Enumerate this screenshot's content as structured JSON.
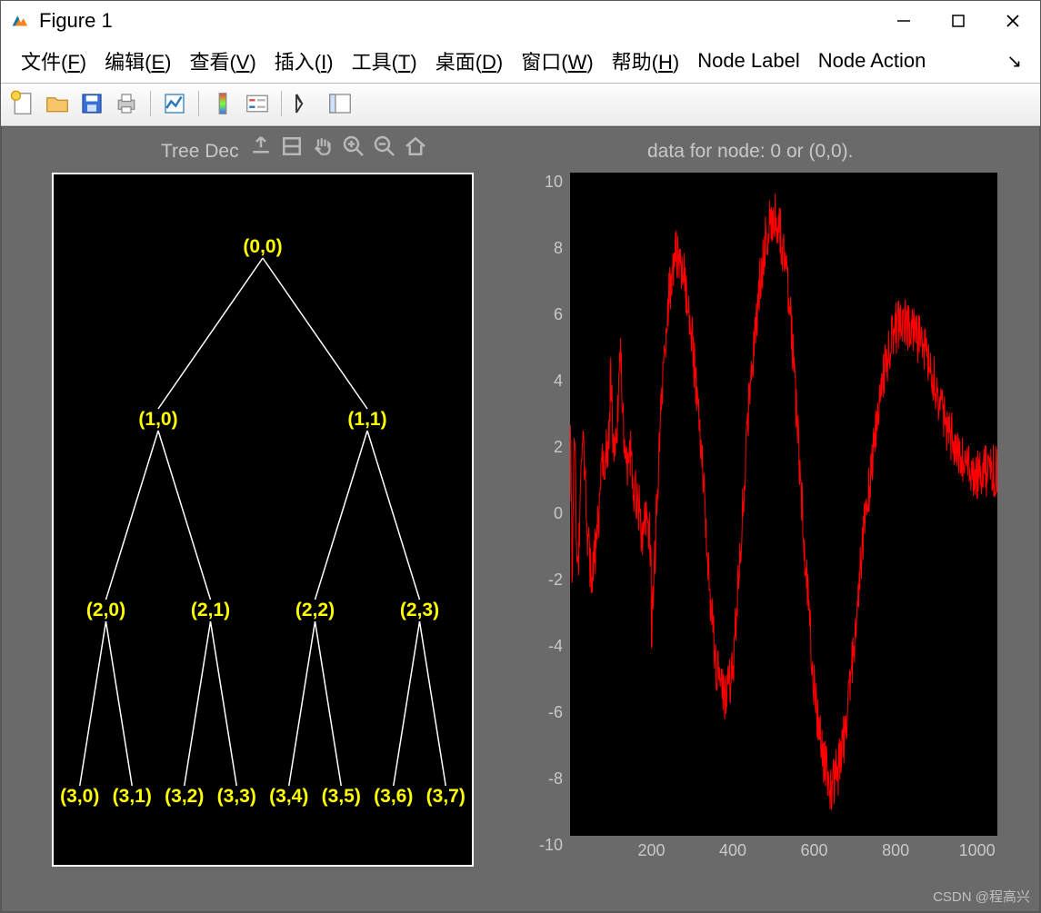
{
  "window": {
    "title": "Figure 1"
  },
  "menu": {
    "file": "文件(F)",
    "edit": "编辑(E)",
    "view": "查看(V)",
    "insert": "插入(I)",
    "tools": "工具(T)",
    "desktop": "桌面(D)",
    "window": "窗口(W)",
    "help": "帮助(H)",
    "node_label": "Node Label",
    "node_action": "Node Action"
  },
  "left_panel": {
    "title": "Tree Dec",
    "nodes": [
      {
        "label": "(0,0)",
        "level": 0,
        "pos": 0
      },
      {
        "label": "(1,0)",
        "level": 1,
        "pos": 0
      },
      {
        "label": "(1,1)",
        "level": 1,
        "pos": 1
      },
      {
        "label": "(2,0)",
        "level": 2,
        "pos": 0
      },
      {
        "label": "(2,1)",
        "level": 2,
        "pos": 1
      },
      {
        "label": "(2,2)",
        "level": 2,
        "pos": 2
      },
      {
        "label": "(2,3)",
        "level": 2,
        "pos": 3
      },
      {
        "label": "(3,0)",
        "level": 3,
        "pos": 0
      },
      {
        "label": "(3,1)",
        "level": 3,
        "pos": 1
      },
      {
        "label": "(3,2)",
        "level": 3,
        "pos": 2
      },
      {
        "label": "(3,3)",
        "level": 3,
        "pos": 3
      },
      {
        "label": "(3,4)",
        "level": 3,
        "pos": 4
      },
      {
        "label": "(3,5)",
        "level": 3,
        "pos": 5
      },
      {
        "label": "(3,6)",
        "level": 3,
        "pos": 6
      },
      {
        "label": "(3,7)",
        "level": 3,
        "pos": 7
      }
    ]
  },
  "right_panel": {
    "title": "data for node: 0 or (0,0).",
    "xticks": [
      200,
      400,
      600,
      800,
      1000
    ],
    "yticks": [
      -10,
      -8,
      -6,
      -4,
      -2,
      0,
      2,
      4,
      6,
      8,
      10
    ]
  },
  "watermark": "CSDN @程高兴",
  "chart_data": {
    "type": "line",
    "title": "data for node: 0 or (0,0).",
    "xlabel": "",
    "ylabel": "",
    "xlim": [
      0,
      1050
    ],
    "ylim": [
      -10,
      10
    ],
    "series": [
      {
        "name": "node (0,0)",
        "color": "#ff0000",
        "note": "Noisy chirp-like signal: rapid high-amplitude oscillations (~±7) for x<200 whose period lengthens with x, broadening into three large cycles between x≈200–900 with peaks ~7, 8.8, 5.5 and troughs ~-6, -8.5, then settling near ~1 by x≈1000. High-frequency noise (~±1) is superimposed throughout. Values below are visually estimated samples at coarse x.",
        "x": [
          0,
          25,
          50,
          75,
          100,
          125,
          150,
          175,
          200,
          220,
          240,
          260,
          280,
          300,
          320,
          340,
          360,
          380,
          400,
          420,
          440,
          460,
          480,
          500,
          520,
          540,
          560,
          580,
          600,
          620,
          640,
          660,
          680,
          700,
          720,
          740,
          760,
          780,
          800,
          820,
          840,
          860,
          880,
          900,
          920,
          940,
          960,
          980,
          1000,
          1020,
          1040
        ],
        "values": [
          -1,
          3,
          -2,
          5,
          -4,
          6,
          -5,
          7,
          -4,
          2,
          6,
          7.5,
          7,
          5,
          2,
          -2,
          -5,
          -6,
          -5,
          -1,
          3,
          6,
          8,
          8.8,
          8,
          6,
          2,
          -2,
          -5.5,
          -7.5,
          -8.5,
          -8,
          -6.5,
          -4,
          -1,
          1,
          3,
          4.5,
          5.3,
          5.5,
          5.2,
          5,
          4.5,
          3.5,
          2.5,
          2,
          1.3,
          1,
          0.8,
          1,
          1
        ]
      }
    ]
  }
}
